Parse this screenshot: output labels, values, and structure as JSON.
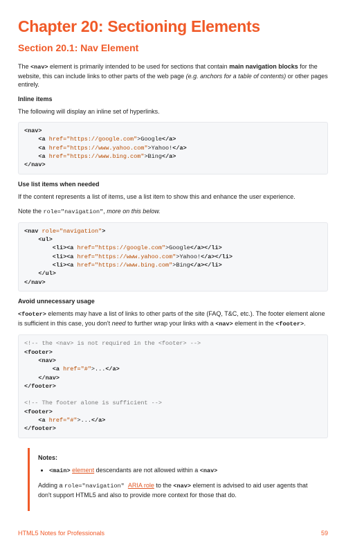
{
  "chapter": {
    "title": "Chapter 20: Sectioning Elements"
  },
  "section": {
    "title": "Section 20.1: Nav Element"
  },
  "intro": {
    "pre": "The ",
    "code": "<nav>",
    "mid": " element is primarily intended to be used for sections that contain ",
    "bold": "main navigation blocks",
    "post1": " for the website, this can include links to other parts of the web page ",
    "ital": "(e.g. anchors for a table of contents)",
    "post2": " or other pages entirely."
  },
  "inline_heading": "Inline items",
  "inline_desc": "The following will display an inline set of hyperlinks.",
  "list_heading": "Use list items when needed",
  "list_desc": "If the content represents a list of items, use a list item to show this and enhance the user experience.",
  "note_role_pre": "Note the ",
  "note_role_code": "role=\"navigation\"",
  "note_role_post": ", ",
  "note_role_ital": "more on this below.",
  "avoid_heading": "Avoid unnecessary usage",
  "avoid_para": {
    "code1": "<footer>",
    "t1": " elements may have a list of links to other parts of the site (FAQ, T&C, etc.). The footer element alone is sufficient in this case, you don't ",
    "ital": "need",
    "t2": " to further wrap your links with a ",
    "code2": "<nav>",
    "t3": " element in the ",
    "code3": "<footer>",
    "t4": "."
  },
  "notes": {
    "title": "Notes:",
    "bullet_code": "<main>",
    "bullet_link": "element",
    "bullet_rest": " descendants are not allowed within a ",
    "bullet_code2": "<nav>",
    "para_pre": "Adding a ",
    "para_code": "role=\"navigation\" ",
    "para_link": "ARIA role",
    "para_mid": " to the ",
    "para_code2": "<nav>",
    "para_post": " element is advised to aid user agents that don't support HTML5 and also to provide more context for those that do."
  },
  "footer": {
    "left": "HTML5 Notes for Professionals",
    "right": "59"
  },
  "code1": {
    "l1o": "<nav>",
    "l1c": "",
    "l2a": "    <a ",
    "l2b": "href=\"https://google.com\"",
    "l2c": ">Google",
    "l2d": "</a>",
    "l3a": "    <a ",
    "l3b": "href=\"https://www.yahoo.com\"",
    "l3c": ">Yahoo!",
    "l3d": "</a>",
    "l4a": "    <a ",
    "l4b": "href=\"https://www.bing.com\"",
    "l4c": ">Bing",
    "l4d": "</a>",
    "l5": "</nav>"
  },
  "code2": {
    "l1a": "<nav ",
    "l1b": "role=\"navigation\"",
    "l1c": ">",
    "l2": "    <ul>",
    "l3a": "        <li><a ",
    "l3b": "href=\"https://google.com\"",
    "l3c": ">Google",
    "l3d": "</a></li>",
    "l4a": "        <li><a ",
    "l4b": "href=\"https://www.yahoo.com\"",
    "l4c": ">Yahoo!",
    "l4d": "</a></li>",
    "l5a": "        <li><a ",
    "l5b": "href=\"https://www.bing.com\"",
    "l5c": ">Bing",
    "l5d": "</a></li>",
    "l6": "    </ul>",
    "l7": "</nav>"
  },
  "code3": {
    "c1": "<!-- the <nav> is not required in the <footer> -->",
    "l1": "<footer>",
    "l2": "    <nav>",
    "l3a": "        <a ",
    "l3b": "href=\"#\"",
    "l3c": ">...",
    "l3d": "</a>",
    "l4": "    </nav>",
    "l5": "</footer>",
    "blank": "",
    "c2": "<!-- The footer alone is sufficient -->",
    "l6": "<footer>",
    "l7a": "    <a ",
    "l7b": "href=\"#\"",
    "l7c": ">...",
    "l7d": "</a>",
    "l8": "</footer>"
  }
}
